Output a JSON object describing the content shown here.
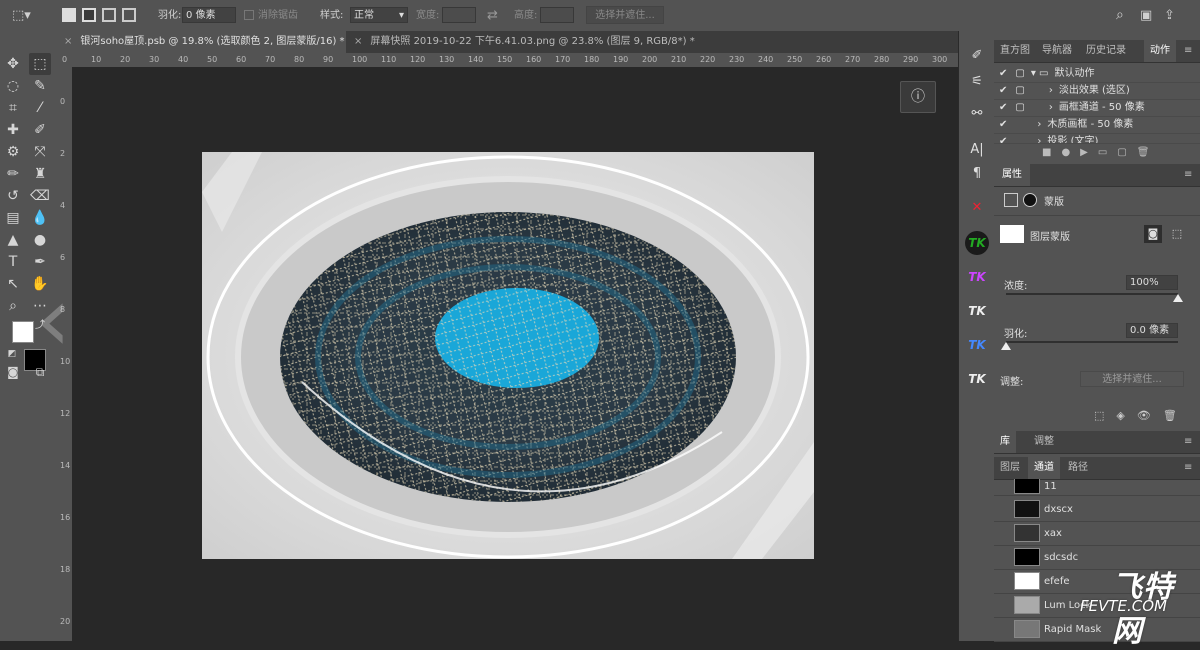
{
  "options_bar": {
    "feather_label": "羽化:",
    "feather_value": "0 像素",
    "antialias_label": "消除锯齿",
    "style_label": "样式:",
    "style_value": "正常",
    "width_label": "宽度:",
    "height_label": "高度:",
    "select_mask_button": "选择并遮住..."
  },
  "document_tabs": [
    {
      "label": "银河soho屋顶.psb @ 19.8% (选取颜色 2, 图层蒙版/16) *"
    },
    {
      "label": "屏幕快照 2019-10-22 下午6.41.03.png @ 23.8% (图层 9, RGB/8*) *"
    }
  ],
  "rulers": {
    "top_ticks": [
      "0",
      "10",
      "20",
      "30",
      "40",
      "50",
      "60",
      "70",
      "80",
      "90",
      "100",
      "110",
      "120",
      "130",
      "140",
      "150",
      "160",
      "170",
      "180",
      "190",
      "200",
      "210",
      "220",
      "230",
      "240",
      "250",
      "260",
      "270",
      "280",
      "290",
      "300"
    ],
    "left_ticks": [
      "0",
      "2",
      "4",
      "6",
      "8",
      "1 0",
      "1 2",
      "1 4",
      "1 6",
      "1 8",
      "2 0"
    ]
  },
  "actions_panel": {
    "tabs": [
      {
        "label": "直方图"
      },
      {
        "label": "导航器"
      },
      {
        "label": "历史记录"
      },
      {
        "label": "动作"
      }
    ],
    "items": [
      {
        "label": "默认动作"
      },
      {
        "label": "淡出效果 (选区)"
      },
      {
        "label": "画框通道 - 50 像素"
      },
      {
        "label": "木质画框 - 50 像素"
      },
      {
        "label": "投影 (文字)"
      }
    ]
  },
  "properties_panel": {
    "title": "属性",
    "mask_label": "蒙版",
    "layer_mask_label": "图层蒙版",
    "density_label": "浓度:",
    "density_value": "100%",
    "density_level": 1.0,
    "feather_label": "羽化:",
    "feather_value": "0.0 像素",
    "feather_level": 0.0,
    "adjust_label": "调整:",
    "select_mask_button": "选择并遮住..."
  },
  "library_tabs": [
    {
      "label": "库"
    },
    {
      "label": "调整"
    }
  ],
  "layers_tabs": [
    {
      "label": "图层"
    },
    {
      "label": "通道"
    },
    {
      "label": "路径"
    }
  ],
  "channels": [
    {
      "name": "11"
    },
    {
      "name": "dxscx"
    },
    {
      "name": "xax"
    },
    {
      "name": "sdcsdc"
    },
    {
      "name": "efefe"
    },
    {
      "name": "Lum Lock"
    },
    {
      "name": "Rapid Mask"
    }
  ],
  "watermark": {
    "main": "飞特网",
    "sub": "FEVTE.COM"
  },
  "colors": {
    "ui_panel": "#535353",
    "canvas_bg": "#282828",
    "dome_blue": "#1aa7d8",
    "accent_white": "#ffffff"
  }
}
